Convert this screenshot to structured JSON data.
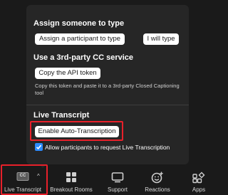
{
  "popover": {
    "assign": {
      "title": "Assign someone to type",
      "assign_button": "Assign a participant to type",
      "self_button": "I will type"
    },
    "third_party": {
      "title": "Use a 3rd-party CC service",
      "copy_button": "Copy the API token",
      "hint": "Copy this token and paste it to a 3rd-party Closed Captioning tool"
    },
    "live_transcript": {
      "title": "Live Transcript",
      "enable_button": "Enable Auto-Transcription",
      "allow_checkbox_label": "Allow participants to request Live Transcription",
      "allow_checked": true
    }
  },
  "toolbar": {
    "items": [
      {
        "label": "Live Transcript",
        "icon": "cc-icon",
        "icon_text": "CC"
      },
      {
        "label": "Breakout Rooms",
        "icon": "breakout-rooms-icon"
      },
      {
        "label": "Support",
        "icon": "support-icon"
      },
      {
        "label": "Reactions",
        "icon": "reactions-icon"
      },
      {
        "label": "Apps",
        "icon": "apps-icon"
      }
    ]
  },
  "colors": {
    "highlight": "#e8202a",
    "checkbox": "#2d8cff",
    "popover_bg": "#262626",
    "page_bg": "#1a1a1a"
  }
}
